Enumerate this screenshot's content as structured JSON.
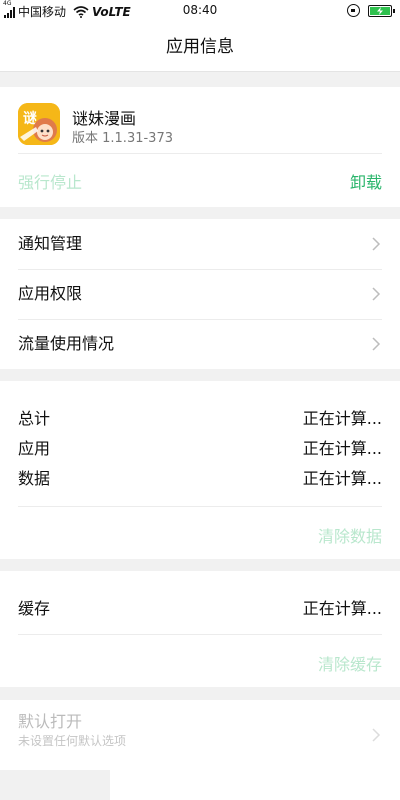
{
  "status_bar": {
    "network_tag": "4G",
    "carrier": "中国移动",
    "volte": "VoLTE",
    "time": "08:40",
    "icons": [
      "signal-icon",
      "wifi-icon",
      "rotation-lock-icon",
      "battery-charging-icon"
    ]
  },
  "header": {
    "title": "应用信息"
  },
  "app": {
    "name": "谜妹漫画",
    "version": "版本 1.1.31-373",
    "force_stop_label": "强行停止",
    "uninstall_label": "卸载",
    "icon_glyph": "谜"
  },
  "menu": {
    "items": [
      {
        "label": "通知管理"
      },
      {
        "label": "应用权限"
      },
      {
        "label": "流量使用情况"
      }
    ]
  },
  "storage": {
    "rows": [
      {
        "label": "总计",
        "value": "正在计算..."
      },
      {
        "label": "应用",
        "value": "正在计算..."
      },
      {
        "label": "数据",
        "value": "正在计算..."
      }
    ],
    "clear_data_label": "清除数据"
  },
  "cache": {
    "label": "缓存",
    "value": "正在计算...",
    "clear_cache_label": "清除缓存"
  },
  "default_open": {
    "title": "默认打开",
    "subtitle": "未设置任何默认选项"
  },
  "colors": {
    "accent_green": "#2ab56b",
    "disabled_green": "#b9e7cd",
    "page_background": "#f1f1f1",
    "app_icon_background": "#f5b718"
  }
}
